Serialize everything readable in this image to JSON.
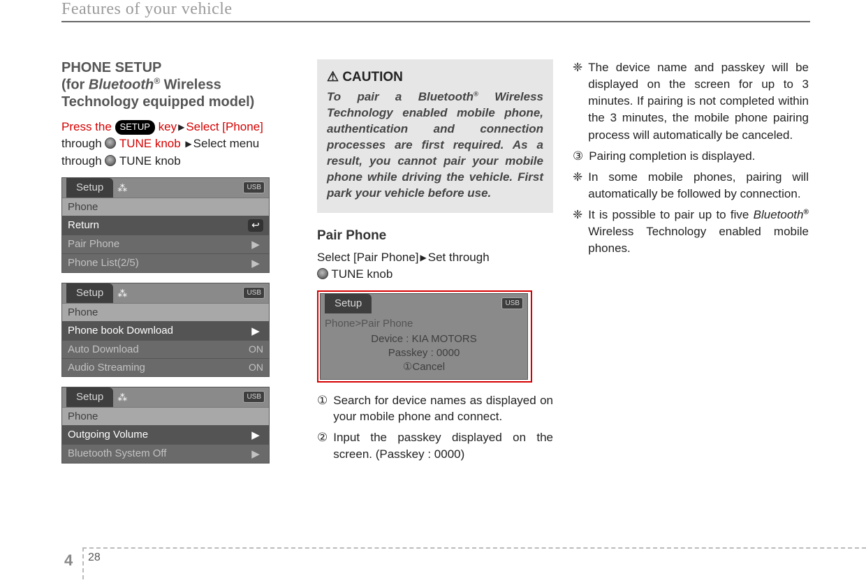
{
  "header": {
    "title": "Features of your vehicle"
  },
  "col1": {
    "title_line1": "PHONE SETUP",
    "title_line2_pre": "(for ",
    "title_line2_bt": "Bluetooth",
    "title_line2_sup": "®",
    "title_line2_post": " Wireless Technology equipped model)",
    "instr_press": "Press the ",
    "setup_key": "SETUP",
    "instr_key_post": " key",
    "instr_select_phone": "Select [Phone]",
    "instr_through1": "through ",
    "tune_knob_red": "TUNE knob",
    "instr_select_menu": "Select menu",
    "instr_through2": "through ",
    "tune_knob_black": "TUNE knob",
    "screen1": {
      "tab": "Setup",
      "usb": "USB",
      "sub": "Phone",
      "r1": "Return",
      "r2": "Pair Phone",
      "r3": "Phone List(2/5)"
    },
    "screen2": {
      "tab": "Setup",
      "usb": "USB",
      "sub": "Phone",
      "r1": "Phone book Download",
      "r2": "Auto Download",
      "r2_right": "ON",
      "r3": "Audio Streaming",
      "r3_right": "ON"
    },
    "screen3": {
      "tab": "Setup",
      "usb": "USB",
      "sub": "Phone",
      "r1": "Outgoing Volume",
      "r2": "Bluetooth System Off"
    }
  },
  "col2": {
    "caution": {
      "head": "CAUTION",
      "body_pre": "To pair a Bluetooth",
      "body_sup": "®",
      "body_post": " Wireless Technology enabled mobile phone, authentication and connection processes are first required. As a result, you cannot pair your mobile phone while driving the vehicle. First park your vehicle before use."
    },
    "pair_head": "Pair Phone",
    "pair_instr_pre": "Select [Pair Phone]",
    "pair_instr_post": "Set through",
    "pair_instr_line2": " TUNE knob",
    "screen": {
      "tab": "Setup",
      "usb": "USB",
      "bc": "Phone>Pair Phone",
      "l1": "Device : KIA MOTORS",
      "l2": "Passkey : 0000",
      "l3": "①Cancel"
    },
    "steps": {
      "s1_num": "①",
      "s1": "Search for device names as displayed on your mobile phone and connect.",
      "s2_num": "②",
      "s2": "Input the passkey displayed on the screen. (Passkey : 0000)"
    }
  },
  "col3": {
    "i1_bullet": "❈",
    "i1": "The device name and passkey will be displayed on the screen for up to 3 minutes. If pairing is not completed within the 3 minutes, the mobile phone pairing process will automatically be canceled.",
    "i2_bullet": "③",
    "i2": "Pairing completion is displayed.",
    "i3_bullet": "❈",
    "i3": "In some mobile phones, pairing will automatically be followed by connection.",
    "i4_bullet": "❈",
    "i4_pre": "It is possible to pair up to five ",
    "i4_bt": "Bluetooth",
    "i4_sup": "®",
    "i4_post": " Wireless Technology enabled mobile phones."
  },
  "footer": {
    "chapter": "4",
    "page": "28"
  }
}
